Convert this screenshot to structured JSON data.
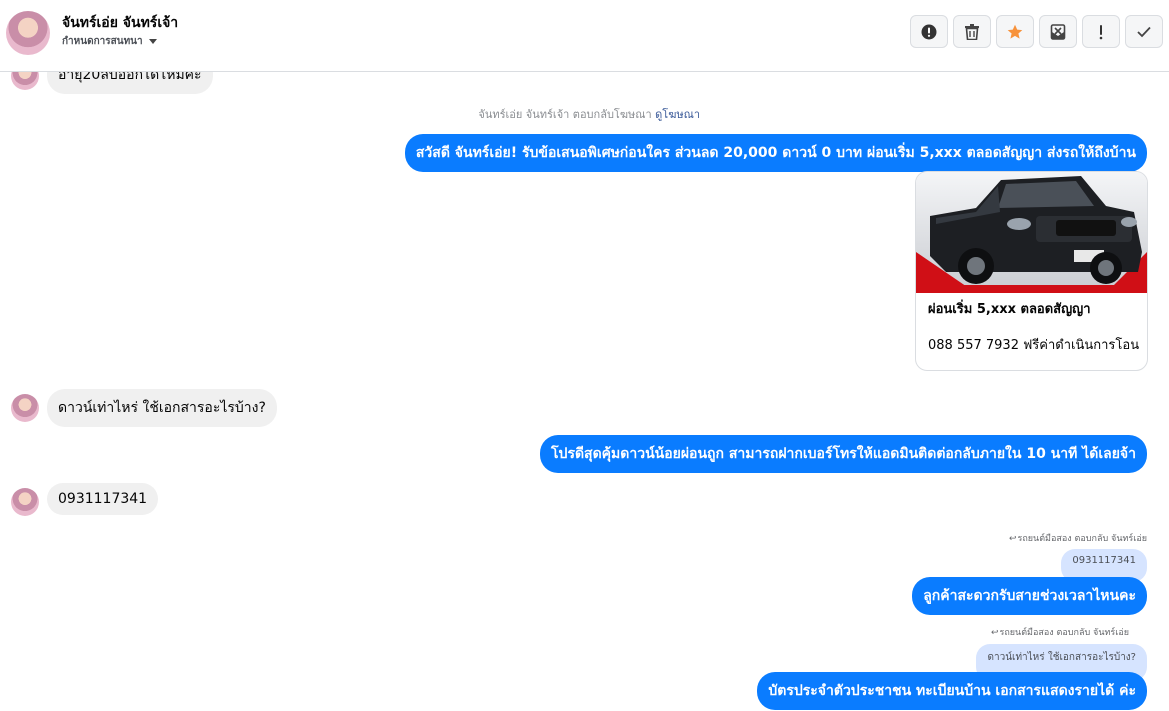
{
  "header": {
    "contact_name": "จันทร์เอ่ย จันทร์เจ้า",
    "conversation_action": "กำหนดการสนทนา",
    "toolbar": [
      {
        "name": "alert-button",
        "icon": "exclamation-circle-icon"
      },
      {
        "name": "delete-button",
        "icon": "trash-icon"
      },
      {
        "name": "star-button",
        "icon": "star-icon",
        "color": "#f7923b"
      },
      {
        "name": "mark-unread-button",
        "icon": "envelope-icon"
      },
      {
        "name": "important-button",
        "icon": "exclamation-icon"
      },
      {
        "name": "done-button",
        "icon": "checkmark-icon"
      }
    ]
  },
  "messages": {
    "partial_incoming": "อายุ20ลบออกได้ไหมค่ะ",
    "ad_reply_meta": "จันทร์เอ่ย จันทร์เจ้า ตอบกลับโฆษณา",
    "ad_link": "ดูโฆษณา",
    "ad_greeting": "สวัสดี จันทร์เอ่ย! รับข้อเสนอพิเศษก่อนใคร ส่วนลด 20,000 ดาวน์ 0 บาท ผ่อนเริ่ม 5,xxx ตลอดสัญญา ส่งรถให้ถึงบ้าน",
    "ad_card": {
      "headline": "ผ่อนเริ่ม 5,xxx ตลอดสัญญา",
      "description": "088 557 7932 ฟรีค่าดำเนินการโอน"
    },
    "incoming_1": "ดาวน์เท่าไหร่ ใช้เอกสารอะไรบ้าง?",
    "outgoing_1": "โปรดีสุดคุ้มดาวน์น้อยผ่อนถูก สามารถฝากเบอร์โทรให้แอดมินติดต่อกลับภายใน 10 นาที ได้เลยจ้า",
    "incoming_2": "0931117341",
    "reply_1": {
      "meta": "รถยนต์มือสอง ตอบกลับ จันทร์เอ่ย",
      "quoted": "0931117341",
      "text": "ลูกค้าสะดวกรับสายช่วงเวลาไหนคะ"
    },
    "reply_2": {
      "meta": "รถยนต์มือสอง ตอบกลับ จันทร์เอ่ย",
      "quoted": "ดาวน์เท่าไหร่ ใช้เอกสารอะไรบ้าง?",
      "text": "บัตรประจำตัวประชาชน ทะเบียนบ้าน เอกสารแสดงรายได้ ค่ะ"
    }
  },
  "colors": {
    "outgoing_bubble": "#0a7cff",
    "incoming_bubble": "#f0f0f0",
    "quoted_bubble": "#d6e4ff",
    "star": "#f7923b"
  }
}
